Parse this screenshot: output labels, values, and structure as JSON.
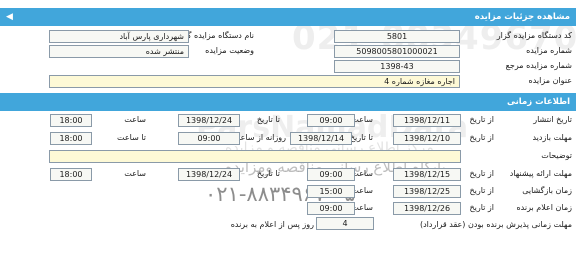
{
  "details": {
    "header": "مشاهده جزئیات مزایده",
    "auctioneer_code_label": "کد دستگاه مزایده گزار",
    "auctioneer_code": "5801",
    "auctioneer_name_label": "نام دستگاه مزایده گزار",
    "auctioneer_name": "شهرداری پارس آباد",
    "auction_number_label": "شماره مزایده",
    "auction_number": "5098005801000021",
    "auction_status_label": "وضعیت مزایده",
    "auction_status": "منتشر شده",
    "reference_number_label": "شماره مزایده مرجع",
    "reference_number": "1398-43",
    "title_label": "عنوان مزایده",
    "title": "اجاره مغازه شماره 4"
  },
  "timing": {
    "header": "اطلاعات زمانی",
    "publish_label": "تاریخ انتشار",
    "from_date_label": "از تاریخ",
    "to_date_label": "تا تاریخ",
    "time_label": "ساعت",
    "until_time_label": "تا ساعت",
    "daily_from_label": "روزانه از ساعت",
    "publish_from_date": "1398/12/11",
    "publish_from_time": "09:00",
    "publish_to_date": "1398/12/24",
    "publish_to_time": "18:00",
    "visit_label": "مهلت بازدید",
    "visit_from_date": "1398/12/10",
    "visit_to_date": "1398/12/14",
    "visit_daily_from": "09:00",
    "visit_until_time": "18:00",
    "description_label": "توضیحات",
    "description": "",
    "offer_label": "مهلت ارائه پیشنهاد",
    "offer_from_date": "1398/12/15",
    "offer_from_time": "09:00",
    "offer_to_date": "1398/12/24",
    "offer_to_time": "18:00",
    "opening_label": "زمان بازگشایی",
    "opening_date": "1398/12/25",
    "opening_time": "15:00",
    "announce_label": "زمان اعلام برنده",
    "announce_date": "1398/12/26",
    "announce_time": "09:00",
    "acceptance_label": "مهلت زمانی پذیرش برنده بودن (عقد قرارداد)",
    "acceptance_days": "4",
    "acceptance_suffix": "روز پس از اعلام به برنده"
  },
  "watermark": {
    "top_digits": "021-88349670",
    "brand": "ParsNamadData",
    "line1": "مرکز اطلاع رسانی مناقصه و مزایده",
    "line2": "پایگاه اطلاع رسانی مناقصه ومزایده",
    "phone": "۰۲۱-۸۸۳۴۹۶۷۰-۵"
  },
  "colors": {
    "header_bg": "#41a6db",
    "field_bg": "#f7f8f4",
    "field_yellow": "#fdf9d6"
  }
}
